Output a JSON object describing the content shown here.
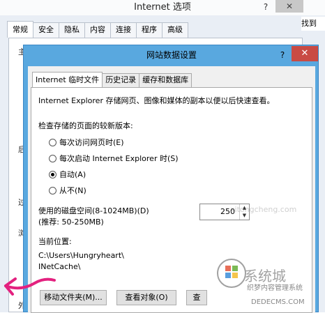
{
  "background_window": {
    "title": "Internet 选项",
    "help_glyph": "?",
    "close_glyph": "✕",
    "tabs": [
      "常规",
      "安全",
      "隐私",
      "内容",
      "连接",
      "程序",
      "高级"
    ],
    "right_edge_text": "找到",
    "left_edge_fragments": [
      "主",
      "后",
      "过",
      "浏",
      "外"
    ]
  },
  "dialog": {
    "title": "网站数据设置",
    "help_glyph": "?",
    "close_glyph": "✕",
    "tabs": [
      "Internet 临时文件",
      "历史记录",
      "缓存和数据库"
    ],
    "description": "Internet Explorer 存储网页、图像和媒体的副本以便以后快速查看。",
    "check_label": "检查存储的页面的较新版本:",
    "radio_options": [
      "每次访问网页时(E)",
      "每次启动 Internet Explorer 时(S)",
      "自动(A)",
      "从不(N)"
    ],
    "selected_radio": "自动(A)",
    "disk_space_label": "使用的磁盘空间(8-1024MB)(D)",
    "disk_space_recommend": "(推荐: 50-250MB)",
    "disk_space_value": "250",
    "current_location_label": "当前位置:",
    "current_location_line1": "C:\\Users\\Hungryheart\\",
    "current_location_line2": "INetCache\\",
    "buttons": {
      "move_folder": "移动文件夹(M)...",
      "view_objects": "查看对象(O)",
      "view_files": "查"
    }
  },
  "watermark": {
    "brand": "系统城",
    "line2": "织梦内容管理系统",
    "line3": "DEDECMS.COM",
    "url": "xitongcheng.com"
  },
  "colors": {
    "dialog_frame": "#59a8df",
    "close_button": "#c94b44",
    "annotation_arrow": "#e3217f"
  }
}
